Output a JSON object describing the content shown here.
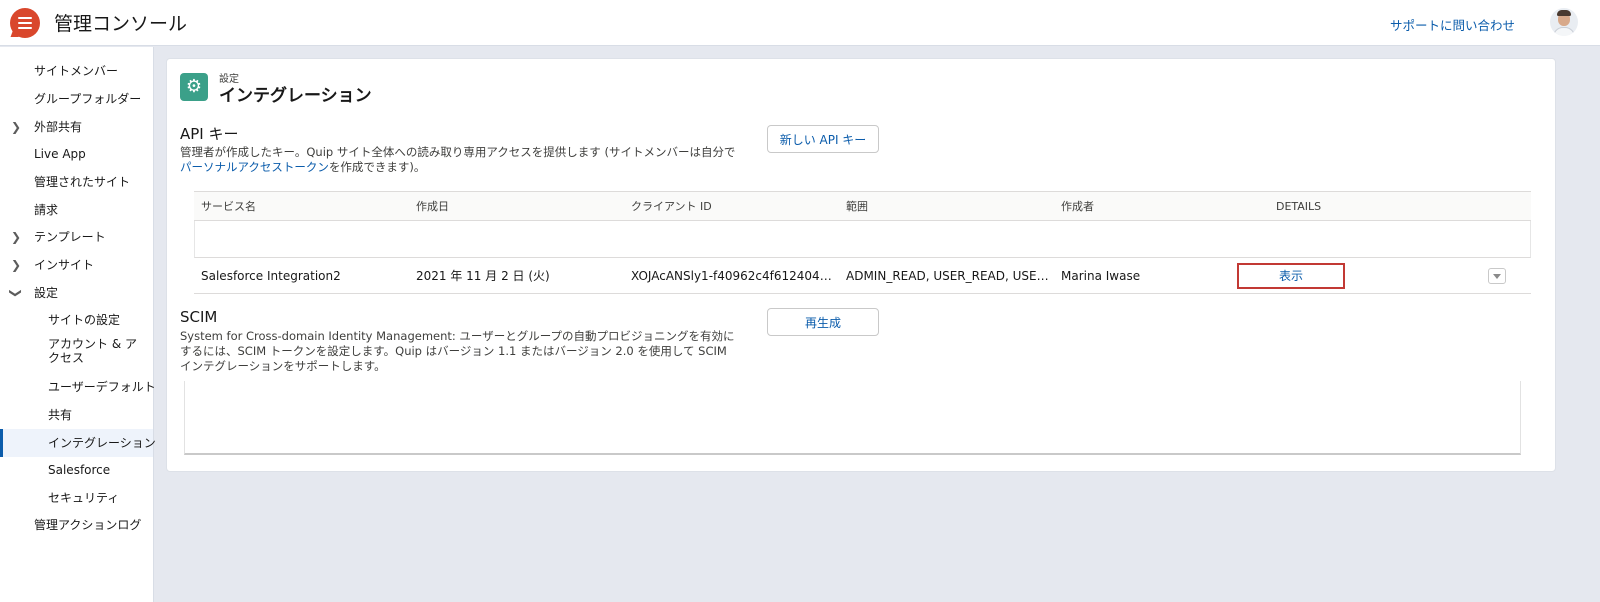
{
  "header": {
    "app_title": "管理コンソール",
    "support_link": "サポートに問い合わせ",
    "logo_icon": "quip-logo-icon",
    "avatar_icon": "user-avatar-icon",
    "brand_color": "#d9472c"
  },
  "sidebar": {
    "items": [
      {
        "label": "サイトメンバー"
      },
      {
        "label": "グループフォルダー"
      },
      {
        "label": "外部共有",
        "chevron": "chevron-right-icon"
      },
      {
        "label": "Live App"
      },
      {
        "label": "管理されたサイト"
      },
      {
        "label": "請求"
      },
      {
        "label": "テンプレート",
        "chevron": "chevron-right-icon"
      },
      {
        "label": "インサイト",
        "chevron": "chevron-right-icon"
      },
      {
        "label": "設定",
        "chevron": "chevron-down-icon"
      },
      {
        "label": "サイトの設定"
      },
      {
        "label": "アカウント & アクセス"
      },
      {
        "label": "ユーザーデフォルト"
      },
      {
        "label": "共有"
      },
      {
        "label": "インテグレーション",
        "active": true
      },
      {
        "label": "Salesforce"
      },
      {
        "label": "セキュリティ"
      },
      {
        "label": "管理アクションログ"
      }
    ]
  },
  "page": {
    "eyebrow": "設定",
    "title": "インテグレーション",
    "icon": "gear-icon",
    "icon_color": "#3ba089"
  },
  "api_keys": {
    "title": "API キー",
    "description_prefix": "管理者が作成したキー。Quip サイト全体への読み取り専用アクセスを提供します (サイトメンバーは自分で",
    "description_link": "パーソナルアクセストークン",
    "description_suffix": "を作成できます)。",
    "new_button": "新しい API キー",
    "columns": [
      "サービス名",
      "作成日",
      "クライアント ID",
      "範囲",
      "作成者",
      "DETAILS"
    ],
    "rows": [
      {
        "service": "Salesforce Integration2",
        "created": "2021 年 11 月 2 日 (火)",
        "client_id": "XOJAcANSly1-f40962c4f6124049b...",
        "scope": "ADMIN_READ, USER_READ, USER_...",
        "author": "Marina Iwase",
        "details": "表示"
      }
    ]
  },
  "scim": {
    "title": "SCIM",
    "description": "System for Cross-domain Identity Management: ユーザーとグループの自動プロビジョニングを有効にするには、SCIM トークンを設定します。Quip はバージョン 1.1 またはバージョン 2.0 を使用して SCIM インテグレーションをサポートします。",
    "regenerate_button": "再生成"
  }
}
